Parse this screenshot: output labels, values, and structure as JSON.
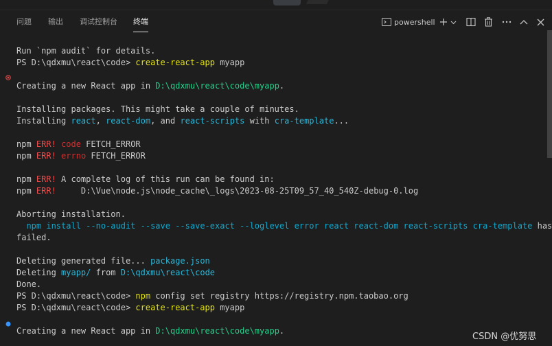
{
  "tabs": [
    {
      "label": "问题",
      "active": false
    },
    {
      "label": "输出",
      "active": false
    },
    {
      "label": "调试控制台",
      "active": false
    },
    {
      "label": "终端",
      "active": true
    }
  ],
  "toolbar": {
    "shell_label": "powershell",
    "shell_icon": "terminal-icon",
    "icons": [
      "plus-icon",
      "chevron-down-icon",
      "split-icon",
      "trash-icon",
      "more-icon",
      "chevron-up-icon",
      "close-icon"
    ]
  },
  "terminal": {
    "lines": [
      {
        "name": "l1",
        "segments": [
          {
            "t": "Run `npm audit` for details."
          }
        ]
      },
      {
        "name": "l2",
        "segments": [
          {
            "t": "PS D:\\qdxmu\\react\\code> "
          },
          {
            "t": "create-react-app",
            "c": "cmd"
          },
          {
            "t": " myapp"
          }
        ]
      },
      {
        "name": "l3",
        "segments": []
      },
      {
        "name": "l4",
        "segments": [
          {
            "t": "Creating a new React app in "
          },
          {
            "t": "D:\\qdxmu\\react\\code\\myapp",
            "c": "path"
          },
          {
            "t": "."
          }
        ]
      },
      {
        "name": "l5",
        "segments": []
      },
      {
        "name": "l6",
        "segments": [
          {
            "t": "Installing packages. This might take a couple of minutes."
          }
        ]
      },
      {
        "name": "l7",
        "segments": [
          {
            "t": "Installing "
          },
          {
            "t": "react",
            "c": "pkg"
          },
          {
            "t": ", "
          },
          {
            "t": "react-dom",
            "c": "pkg"
          },
          {
            "t": ", and "
          },
          {
            "t": "react-scripts",
            "c": "pkg"
          },
          {
            "t": " with "
          },
          {
            "t": "cra-template",
            "c": "pkg"
          },
          {
            "t": "..."
          }
        ]
      },
      {
        "name": "l8",
        "segments": []
      },
      {
        "name": "l9",
        "segments": [
          {
            "t": "npm "
          },
          {
            "t": "ERR!",
            "c": "red"
          },
          {
            "t": " "
          },
          {
            "t": "code",
            "c": "err"
          },
          {
            "t": " FETCH_ERROR"
          }
        ]
      },
      {
        "name": "l10",
        "segments": [
          {
            "t": "npm "
          },
          {
            "t": "ERR!",
            "c": "red"
          },
          {
            "t": " "
          },
          {
            "t": "errno",
            "c": "err"
          },
          {
            "t": " FETCH_ERROR"
          }
        ]
      },
      {
        "name": "l11",
        "segments": []
      },
      {
        "name": "l12",
        "segments": [
          {
            "t": "npm "
          },
          {
            "t": "ERR!",
            "c": "red"
          },
          {
            "t": " A complete log of this run can be found in:"
          }
        ]
      },
      {
        "name": "l13",
        "segments": [
          {
            "t": "npm "
          },
          {
            "t": "ERR!",
            "c": "red"
          },
          {
            "t": "     D:\\Vue\\node.js\\node_cache\\_logs\\2023-08-25T09_57_40_540Z-debug-0.log"
          }
        ]
      },
      {
        "name": "l14",
        "segments": []
      },
      {
        "name": "l15",
        "segments": [
          {
            "t": "Aborting installation."
          }
        ]
      },
      {
        "name": "l16",
        "segments": [
          {
            "t": "  "
          },
          {
            "t": "npm install --no-audit --save --save-exact --loglevel error react react-dom react-scripts cra-template",
            "c": "cyan"
          },
          {
            "t": " has"
          }
        ]
      },
      {
        "name": "l17",
        "segments": [
          {
            "t": "failed."
          }
        ]
      },
      {
        "name": "l18",
        "segments": []
      },
      {
        "name": "l19",
        "segments": [
          {
            "t": "Deleting generated file... "
          },
          {
            "t": "package.json",
            "c": "pkg"
          }
        ]
      },
      {
        "name": "l20",
        "segments": [
          {
            "t": "Deleting "
          },
          {
            "t": "myapp/",
            "c": "pkg"
          },
          {
            "t": " from "
          },
          {
            "t": "D:\\qdxmu\\react\\code",
            "c": "pkg"
          }
        ]
      },
      {
        "name": "l21",
        "segments": [
          {
            "t": "Done."
          }
        ]
      },
      {
        "name": "l22",
        "segments": [
          {
            "t": "PS D:\\qdxmu\\react\\code> "
          },
          {
            "t": "npm",
            "c": "cmd"
          },
          {
            "t": " config set registry https://registry.npm.taobao.org"
          }
        ]
      },
      {
        "name": "l23",
        "segments": [
          {
            "t": "PS D:\\qdxmu\\react\\code> "
          },
          {
            "t": "create-react-app",
            "c": "cmd"
          },
          {
            "t": " myapp"
          }
        ]
      },
      {
        "name": "l24",
        "segments": []
      },
      {
        "name": "l25",
        "segments": [
          {
            "t": "Creating a new React app in "
          },
          {
            "t": "D:\\qdxmu\\react\\code\\myapp",
            "c": "path"
          },
          {
            "t": "."
          }
        ]
      }
    ],
    "decorations": [
      {
        "type": "error",
        "icon": "error-circle-icon",
        "color": "#f14c4c"
      },
      {
        "type": "running",
        "icon": "dot-icon",
        "color": "#3794ff"
      }
    ]
  },
  "watermark": "CSDN @优努思",
  "colors": {
    "background": "#1e1e1e",
    "text": "#cccccc",
    "command": "#e5e510",
    "path": "#23d18b",
    "package": "#29b8db",
    "error_tag": "#f14c4c",
    "error_word": "#cd3131",
    "link_command": "#11a8cd"
  }
}
